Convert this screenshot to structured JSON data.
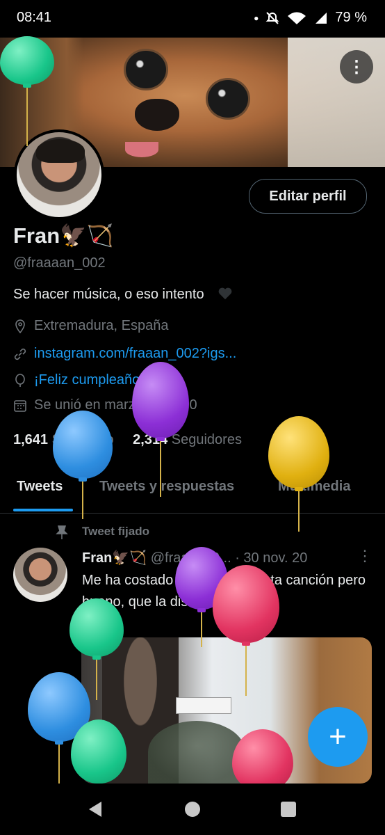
{
  "status_bar": {
    "time": "08:41",
    "battery": "79 %"
  },
  "profile": {
    "edit_button": "Editar perfil",
    "name": "Fran🦅🏹",
    "handle": "@fraaaan_002",
    "bio": "Se hacer música, o eso intento",
    "location": "Extremadura, España",
    "website": "instagram.com/fraaan_002?igs...",
    "birthday": "¡Feliz cumpleaños!",
    "joined": "Se unió en marzo de 2020",
    "following_count": "1,641",
    "following_label": "Siguiendo",
    "followers_count": "2,314",
    "followers_label": "Seguidores"
  },
  "tabs": [
    "Tweets",
    "Tweets y respuestas",
    "Multimedia"
  ],
  "tweet": {
    "pinned_label": "Tweet fijado",
    "author_name": "Fran🦅🏹",
    "author_handle": "@fraaan_0...",
    "date": "· 30 nov. 20",
    "text": "Me ha costado la vida tocar esta canción pero bueno, que la disfrutéis 🙃"
  },
  "colors": {
    "accent": "#1d9bf0",
    "background": "#000000",
    "muted": "#71767b"
  }
}
